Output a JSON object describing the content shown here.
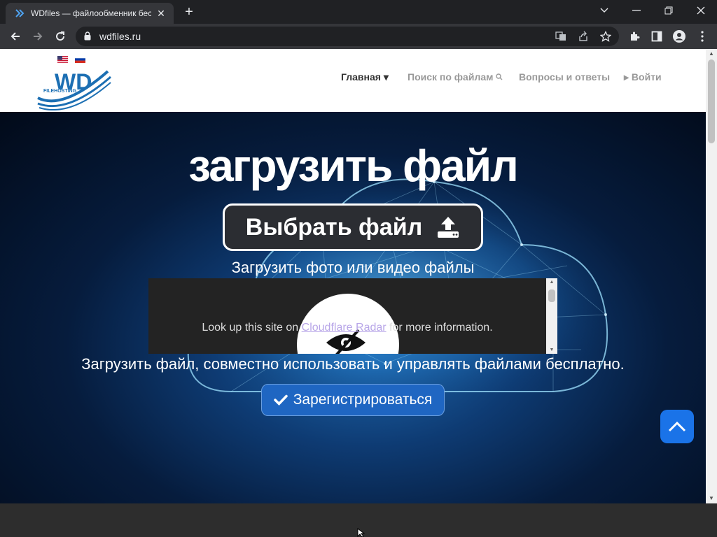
{
  "browser": {
    "tab_title": "WDfiles — файлообменник бесплатный",
    "tab_close": "✕",
    "new_tab": "+",
    "url": "wdfiles.ru"
  },
  "site": {
    "flags": [
      "us-flag",
      "ru-flag"
    ],
    "logo_text": "WD",
    "logo_sub": "FILEHOSTING",
    "nav": {
      "home": "Главная",
      "search": "Поиск по файлам",
      "faq": "Вопросы и ответы",
      "login": "Войти"
    }
  },
  "hero": {
    "title": "загрузить файл",
    "choose_button": "Выбрать файл",
    "upload_sub": "Загрузить фото или видео файлы",
    "description": "Загрузить файл, совместно использовать и управлять файлами бесплатно.",
    "register_button": "Зарегистрироваться"
  },
  "radar_embed": {
    "text_before": "Look up this site on ",
    "link": "Cloudflare Radar",
    "text_after": " for more information."
  },
  "colors": {
    "accent": "#1f66c2",
    "to_top": "#1a73e8",
    "logo_blue": "#1c6fb3"
  }
}
